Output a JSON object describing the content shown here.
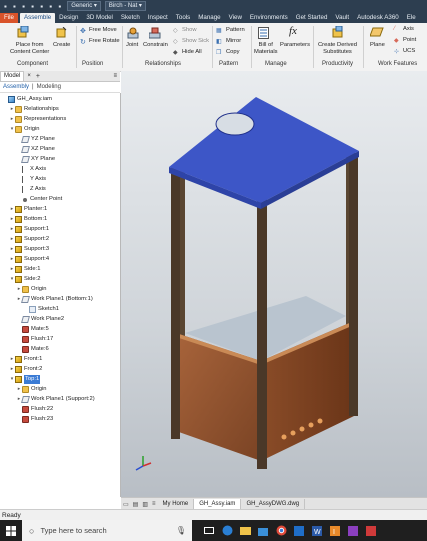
{
  "titlebar": {
    "style_combo": "Generic",
    "material_combo": "Birch - Nat"
  },
  "menu": {
    "items": [
      "File",
      "Assemble",
      "Design",
      "3D Model",
      "Sketch",
      "Inspect",
      "Tools",
      "Manage",
      "View",
      "Environments",
      "Get Started",
      "Vault",
      "Autodesk A360",
      "Ele"
    ]
  },
  "ribbon": {
    "place_from_content_center": "Place from\nContent Center",
    "create": "Create",
    "free_move": "Free Move",
    "free_rotate": "Free Rotate",
    "joint": "Joint",
    "constrain": "Constrain",
    "show": "Show",
    "show_sick": "Show Sick",
    "hide_all": "Hide All",
    "pattern": "Pattern",
    "mirror": "Mirror",
    "copy": "Copy",
    "bill_of_materials": "Bill of\nMaterials",
    "parameters": "Parameters",
    "create_derived_substitutes": "Create Derived\nSubstitutes",
    "plane": "Plane",
    "axis": "Axis",
    "point": "Point",
    "ucs": "UCS",
    "groups": [
      "Component",
      "Position",
      "Relationships",
      "Pattern",
      "Manage",
      "Productivity",
      "Work Features"
    ]
  },
  "browser": {
    "tab_model": "Model",
    "sub_assembly": "Assembly",
    "sub_modeling": "Modeling",
    "tree": [
      {
        "label": "GH_Assy.iam",
        "icon": "assy",
        "indent": 0,
        "exp": ""
      },
      {
        "label": "Relationships",
        "icon": "folder",
        "indent": 1,
        "exp": "▸"
      },
      {
        "label": "Representations",
        "icon": "folder",
        "indent": 1,
        "exp": "▸"
      },
      {
        "label": "Origin",
        "icon": "folder",
        "indent": 1,
        "exp": "▾"
      },
      {
        "label": "YZ Plane",
        "icon": "plane",
        "indent": 2,
        "exp": ""
      },
      {
        "label": "XZ Plane",
        "icon": "plane",
        "indent": 2,
        "exp": ""
      },
      {
        "label": "XY Plane",
        "icon": "plane",
        "indent": 2,
        "exp": ""
      },
      {
        "label": "X Axis",
        "icon": "axis",
        "indent": 2,
        "exp": ""
      },
      {
        "label": "Y Axis",
        "icon": "axis",
        "indent": 2,
        "exp": ""
      },
      {
        "label": "Z Axis",
        "icon": "axis",
        "indent": 2,
        "exp": ""
      },
      {
        "label": "Center Point",
        "icon": "point",
        "indent": 2,
        "exp": ""
      },
      {
        "label": "Planter:1",
        "icon": "part",
        "indent": 1,
        "exp": "▸"
      },
      {
        "label": "Bottom:1",
        "icon": "part",
        "indent": 1,
        "exp": "▸"
      },
      {
        "label": "Support:1",
        "icon": "part",
        "indent": 1,
        "exp": "▸"
      },
      {
        "label": "Support:2",
        "icon": "part",
        "indent": 1,
        "exp": "▸"
      },
      {
        "label": "Support:3",
        "icon": "part",
        "indent": 1,
        "exp": "▸"
      },
      {
        "label": "Support:4",
        "icon": "part",
        "indent": 1,
        "exp": "▸"
      },
      {
        "label": "Side:1",
        "icon": "part",
        "indent": 1,
        "exp": "▸"
      },
      {
        "label": "Side:2",
        "icon": "part",
        "indent": 1,
        "exp": "▾"
      },
      {
        "label": "Origin",
        "icon": "folder",
        "indent": 2,
        "exp": "▸"
      },
      {
        "label": "Work Plane1 (Bottom:1)",
        "icon": "plane",
        "indent": 2,
        "exp": "▸"
      },
      {
        "label": "Sketch1",
        "icon": "doc",
        "indent": 3,
        "exp": ""
      },
      {
        "label": "Work Plane2",
        "icon": "plane",
        "indent": 2,
        "exp": ""
      },
      {
        "label": "Mate:5",
        "icon": "constraint",
        "indent": 2,
        "exp": ""
      },
      {
        "label": "Flush:17",
        "icon": "constraint",
        "indent": 2,
        "exp": ""
      },
      {
        "label": "Mate:6",
        "icon": "constraint",
        "indent": 2,
        "exp": ""
      },
      {
        "label": "Front:1",
        "icon": "part",
        "indent": 1,
        "exp": "▸"
      },
      {
        "label": "Front:2",
        "icon": "part",
        "indent": 1,
        "exp": "▸"
      },
      {
        "label": "Top:1",
        "icon": "part",
        "indent": 1,
        "exp": "▾",
        "selected": true
      },
      {
        "label": "Origin",
        "icon": "folder",
        "indent": 2,
        "exp": "▸"
      },
      {
        "label": "Work Plane1 (Support:2)",
        "icon": "plane",
        "indent": 2,
        "exp": "▸"
      },
      {
        "label": "Flush:22",
        "icon": "constraint",
        "indent": 2,
        "exp": ""
      },
      {
        "label": "Flush:23",
        "icon": "constraint",
        "indent": 2,
        "exp": ""
      }
    ]
  },
  "doc_tabs": {
    "home": "My Home",
    "assy": "GH_Assy.iam",
    "dwg": "GH_AssyDWG.dwg"
  },
  "status": "Ready",
  "taskbar": {
    "search_placeholder": "Type here to search"
  }
}
